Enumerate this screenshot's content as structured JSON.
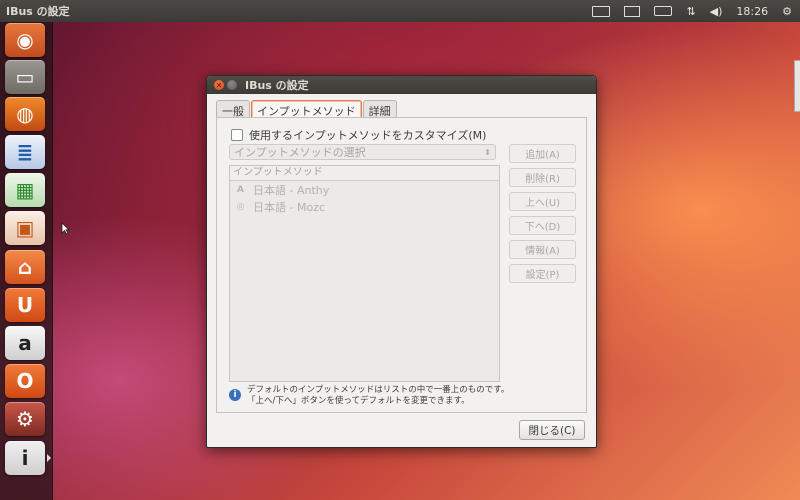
{
  "top_panel": {
    "title": "IBus の設定",
    "clock": "18:26"
  },
  "launcher": {
    "items": [
      {
        "name": "dash-home",
        "glyph": "◉",
        "color": "#d65a2f"
      },
      {
        "name": "files",
        "glyph": "▭",
        "color": "#8a8780"
      },
      {
        "name": "firefox",
        "glyph": "◍",
        "color": "#e06a1f"
      },
      {
        "name": "writer",
        "glyph": "≣",
        "color": "#1f5fa8"
      },
      {
        "name": "calc",
        "glyph": "▦",
        "color": "#2e8b2e"
      },
      {
        "name": "impress",
        "glyph": "▣",
        "color": "#c2571a"
      },
      {
        "name": "software-center",
        "glyph": "⌂",
        "color": "#e2662a"
      },
      {
        "name": "ubuntu-one",
        "glyph": "U",
        "color": "#e25a1c"
      },
      {
        "name": "amazon",
        "glyph": "a",
        "color": "#f2f2f2"
      },
      {
        "name": "ubuntu-one-music",
        "glyph": "O",
        "color": "#e25a1c"
      },
      {
        "name": "system-settings",
        "glyph": "⚙",
        "color": "#9a3d2e"
      },
      {
        "name": "ibus-settings",
        "glyph": "i",
        "color": "#e8e8e8"
      }
    ]
  },
  "window": {
    "title": "IBus の設定",
    "tabs": [
      {
        "label": "一般",
        "active": false
      },
      {
        "label": "インプットメソッド",
        "active": true
      },
      {
        "label": "詳細",
        "active": false
      }
    ],
    "customize_label": "使用するインプットメソッドをカスタマイズ(M)",
    "customize_checked": false,
    "select_placeholder": "インプットメソッドの選択",
    "list_header": "インプットメソッド",
    "engines": [
      {
        "icon_text": "A",
        "label": "日本語 - Anthy"
      },
      {
        "icon_text": "◎",
        "label": "日本語 - Mozc"
      }
    ],
    "side_buttons": {
      "add": "追加(A)",
      "remove": "削除(R)",
      "up": "上へ(U)",
      "down": "下へ(D)",
      "info": "情報(A)",
      "prefs": "設定(P)"
    },
    "info_line1": "デフォルトのインプットメソッドはリストの中で一番上のものです。",
    "info_line2": "「上へ/下へ」ボタンを使ってデフォルトを変更できます。",
    "close_label": "閉じる(C)"
  }
}
